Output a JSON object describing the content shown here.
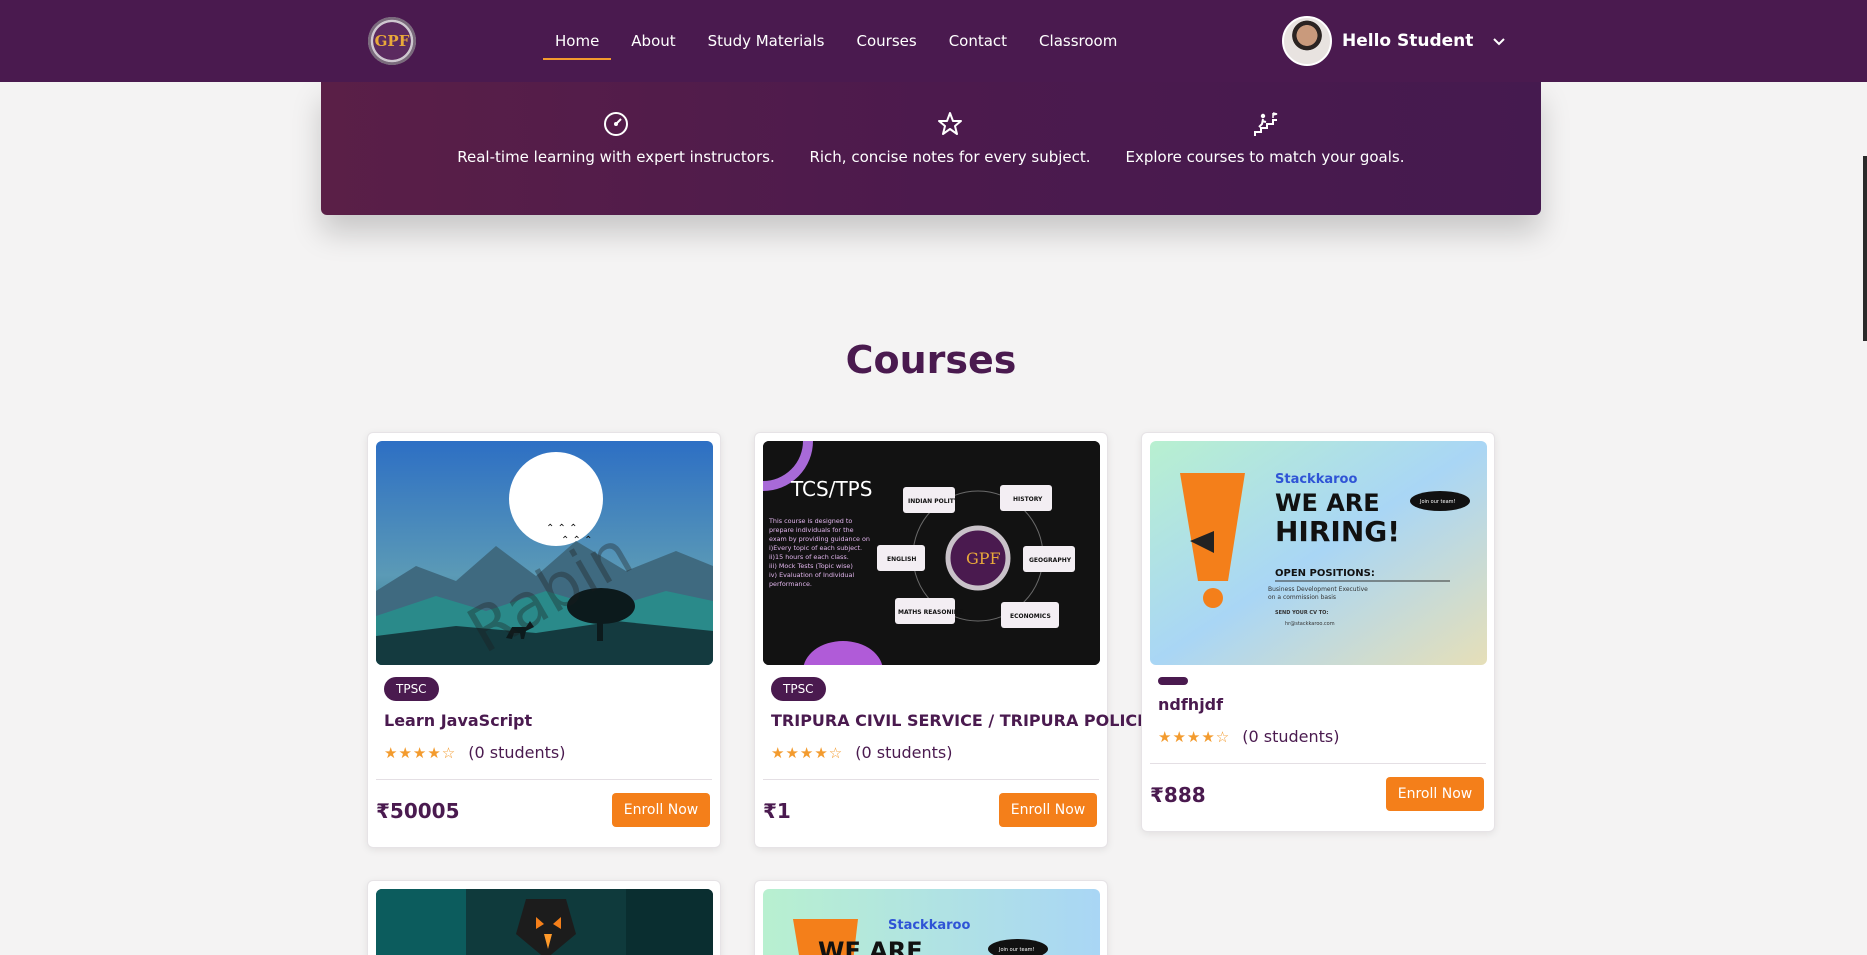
{
  "header": {
    "logo_text": "GPF",
    "nav": [
      "Home",
      "About",
      "Study Materials",
      "Courses",
      "Contact",
      "Classroom"
    ],
    "active": "Home",
    "user_greeting": "Hello Student"
  },
  "features": [
    {
      "icon": "speedometer-icon",
      "text": "Real-time learning with expert instructors."
    },
    {
      "icon": "star-icon",
      "text": "Rich, concise notes for every subject."
    },
    {
      "icon": "climbing-stairs-icon",
      "text": "Explore courses to match your goals."
    }
  ],
  "courses_section": {
    "title": "Courses",
    "cards": [
      {
        "badge": "TPSC",
        "title": "Learn JavaScript",
        "rating": 4.5,
        "students": "(0 students)",
        "price": "₹50005",
        "button": "Enroll Now",
        "thumb_watermark": "Rabin"
      },
      {
        "badge": "TPSC",
        "title": "TRIPURA CIVIL SERVICE / TRIPURA POLICE",
        "rating": 4.5,
        "students": "(0 students)",
        "price": "₹1",
        "button": "Enroll Now",
        "thumb": {
          "heading": "TCS/TPS",
          "lines": [
            "This course is designed to",
            "prepare individuals for the",
            "exam by providing guidance on",
            "i)Every topic of each subject.",
            "ii)15 hours of each class.",
            "iii) Mock Tests (Topic wise)",
            "iv) Evaluation of Individual",
            "performance."
          ],
          "bubbles": [
            "INDIAN POLITY",
            "HISTORY",
            "ENGLISH",
            "GEOGRAPHY",
            "MATHS REASONING",
            "ECONOMICS"
          ],
          "center": "GPF"
        }
      },
      {
        "badge": "",
        "title": "ndfhjdf",
        "rating": 4.5,
        "students": "(0 students)",
        "price": "₹888",
        "button": "Enroll Now",
        "thumb": {
          "brand": "Stackkaroo",
          "line1": "WE ARE",
          "line2": "HIRING!",
          "bubble": "Join our team!",
          "open": "OPEN POSITIONS:",
          "role": "Business Development Executive",
          "role2": "on a commission basis",
          "send": "SEND YOUR CV TO:",
          "email": "hr@stackkaroo.com"
        }
      }
    ],
    "partial_cards": [
      {
        "thumb": "orange-dark-game-art"
      },
      {
        "thumb": {
          "brand": "Stackkaroo",
          "line1": "WE ARE",
          "bubble": "Join our team!"
        }
      }
    ]
  },
  "colors": {
    "primary": "#4a1a4f",
    "accent": "#f47f1a",
    "background": "#f4f3f3"
  }
}
